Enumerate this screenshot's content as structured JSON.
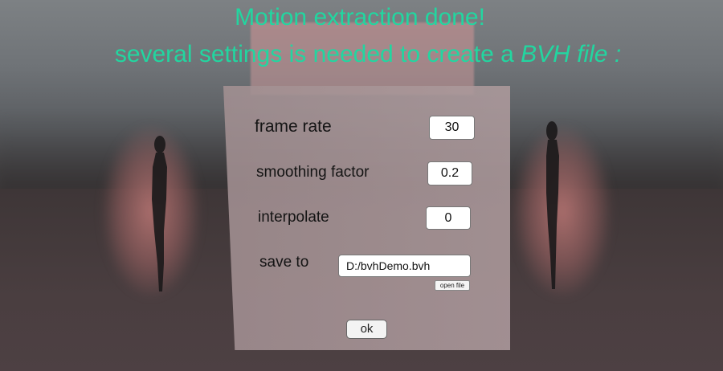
{
  "headline": {
    "line1": "Motion extraction done!",
    "line2_prefix": "several settings is needed to create a ",
    "line2_emphasis": "BVH file :"
  },
  "dialog": {
    "frame_rate": {
      "label": "frame rate",
      "value": "30"
    },
    "smoothing_factor": {
      "label": "smoothing factor",
      "value": "0.2"
    },
    "interpolate": {
      "label": "interpolate",
      "value": "0"
    },
    "save_to": {
      "label": "save to",
      "value": "D:/bvhDemo.bvh"
    },
    "open_file_label": "open file",
    "ok_label": "ok"
  },
  "colors": {
    "headline": "#22d6a0",
    "dialog_bg": "#aa9698"
  }
}
